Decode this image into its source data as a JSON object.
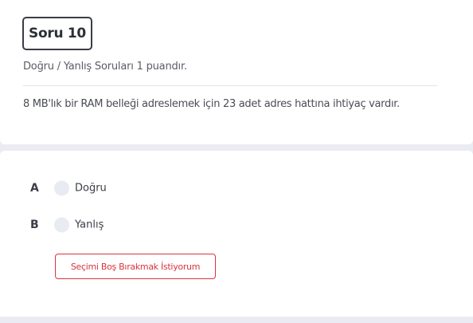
{
  "question": {
    "title": "Soru 10",
    "subtitle": "Doğru / Yanlış Soruları 1 puandır.",
    "text": "8 MB'lık bir RAM belleği adreslemek için 23 adet adres hattına ihtiyaç vardır."
  },
  "options": [
    {
      "letter": "A",
      "label": "Doğru",
      "selected": false
    },
    {
      "letter": "B",
      "label": "Yanlış",
      "selected": false
    }
  ],
  "clear_button": {
    "label": "Seçimi Boş Bırakmak İstiyorum"
  },
  "colors": {
    "background": "#ebebf3",
    "card": "#ffffff",
    "danger": "#d9343f",
    "radio": "#e8ebf1",
    "text": "#3b3e46"
  }
}
